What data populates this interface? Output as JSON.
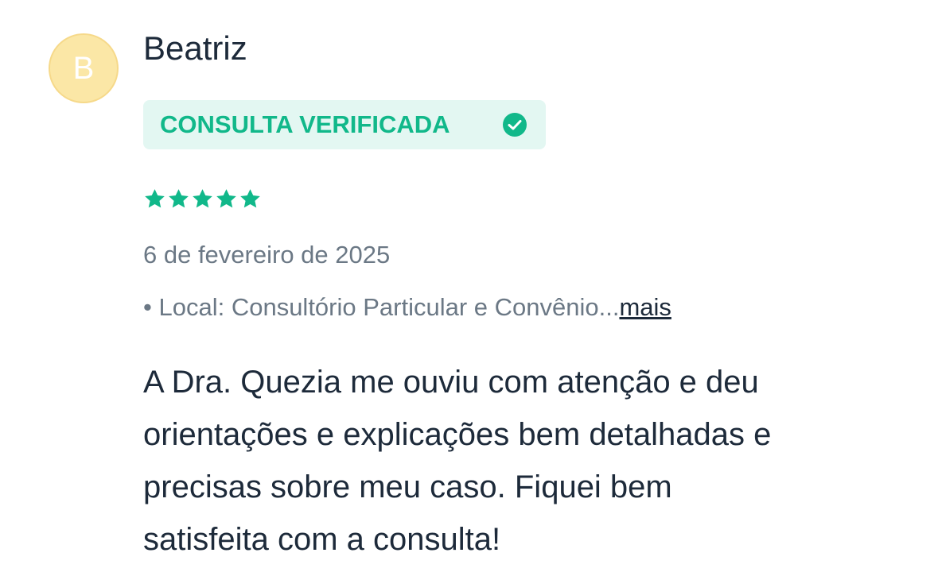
{
  "review": {
    "avatar_initial": "B",
    "author_name": "Beatriz",
    "badge_label": "CONSULTA VERIFICADA",
    "rating": 5,
    "rating_max": 5,
    "date": "6 de fevereiro de 2025",
    "location_bullet": "•",
    "location_text": "Local: Consultório Particular e Convênio...",
    "more_link": "mais",
    "text_lines": [
      "A Dra. Quezia me ouviu com atenção e deu",
      "orientações e explicações bem detalhadas e",
      "precisas sobre meu caso. Fiquei bem",
      "satisfeita com a consulta!"
    ]
  },
  "colors": {
    "accent": "#11b88a",
    "badge_bg": "#e3f7f2",
    "avatar_bg": "#fbe7a6",
    "text_primary": "#1d2a3a",
    "text_secondary": "#6b7885"
  },
  "icons": {
    "badge": "check-circle-icon",
    "rating": "star-icon"
  }
}
